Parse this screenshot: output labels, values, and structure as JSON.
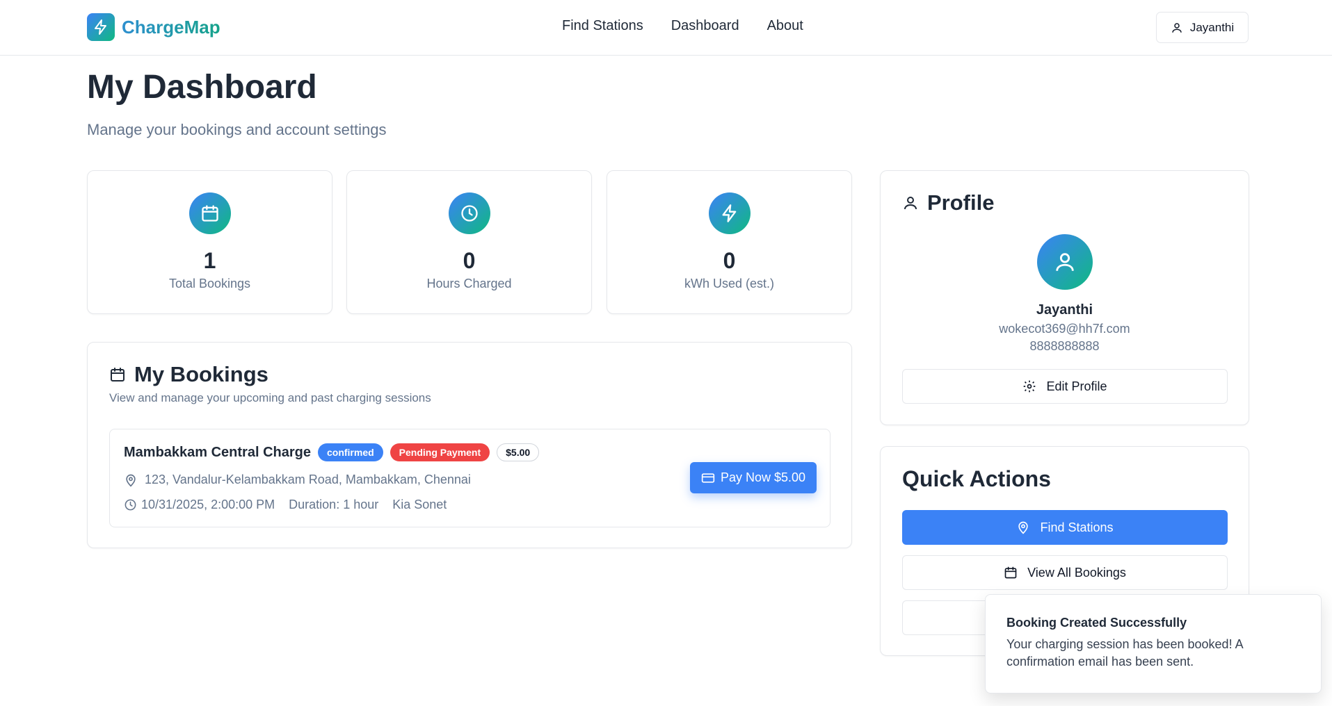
{
  "header": {
    "brand": "ChargeMap",
    "nav": [
      "Find Stations",
      "Dashboard",
      "About"
    ],
    "user_name": "Jayanthi"
  },
  "page": {
    "title": "My Dashboard",
    "subtitle": "Manage your bookings and account settings"
  },
  "stats": [
    {
      "value": "1",
      "label": "Total Bookings",
      "icon": "calendar-icon"
    },
    {
      "value": "0",
      "label": "Hours Charged",
      "icon": "clock-icon"
    },
    {
      "value": "0",
      "label": "kWh Used (est.)",
      "icon": "lightning-icon"
    }
  ],
  "bookings": {
    "title": "My Bookings",
    "description": "View and manage your upcoming and past charging sessions",
    "items": [
      {
        "station": "Mambakkam Central Charge",
        "status": "confirmed",
        "payment_status": "Pending Payment",
        "price": "$5.00",
        "address": "123, Vandalur-Kelambakkam Road, Mambakkam, Chennai",
        "datetime": "10/31/2025, 2:00:00 PM",
        "duration": "Duration: 1 hour",
        "vehicle": "Kia Sonet",
        "pay_label": "Pay Now $5.00"
      }
    ]
  },
  "profile": {
    "title": "Profile",
    "name": "Jayanthi",
    "email": "wokecot369@hh7f.com",
    "phone": "8888888888",
    "edit_label": "Edit Profile"
  },
  "quick_actions": {
    "title": "Quick Actions",
    "find_label": "Find Stations",
    "view_bookings_label": "View All Bookings"
  },
  "toast": {
    "title": "Booking Created Successfully",
    "message": "Your charging session has been booked! A confirmation email has been sent."
  },
  "colors": {
    "primary": "#3b82f6",
    "accent_green": "#10b981",
    "danger": "#ef4444"
  }
}
